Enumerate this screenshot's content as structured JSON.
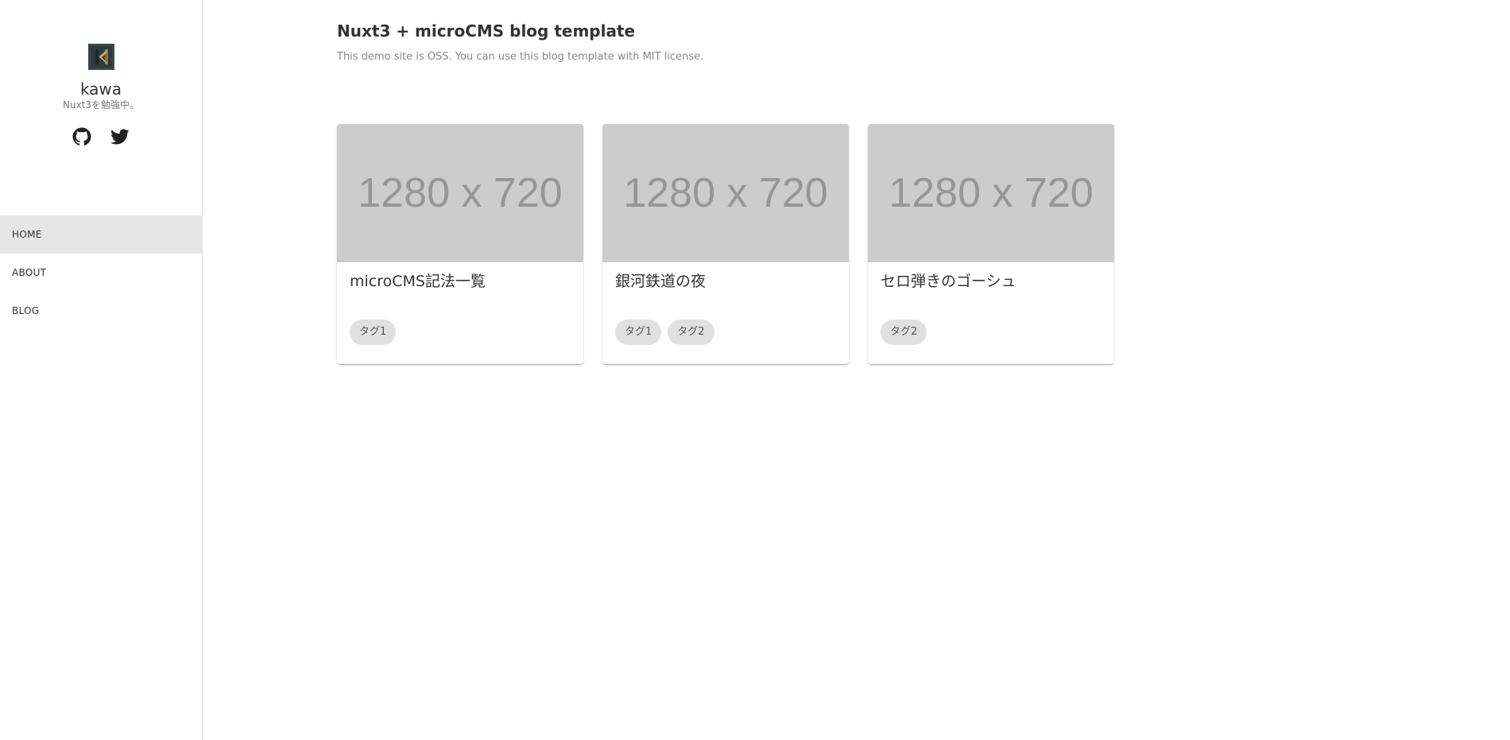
{
  "sidebar": {
    "profile": {
      "avatar_icon": "k-logo-icon",
      "name": "kawa",
      "description": "Nuxt3を勉強中。"
    },
    "social": [
      {
        "icon": "github-icon"
      },
      {
        "icon": "twitter-icon"
      }
    ],
    "nav": [
      {
        "label": "HOME",
        "active": true
      },
      {
        "label": "ABOUT",
        "active": false
      },
      {
        "label": "BLOG",
        "active": false
      }
    ]
  },
  "main": {
    "title": "Nuxt3 + microCMS blog template",
    "subtitle": "This demo site is OSS. You can use this blog template with MIT license.",
    "posts": [
      {
        "thumbnail_text": "1280 x 720",
        "title": "microCMS記法一覧",
        "tags": [
          "タグ1"
        ]
      },
      {
        "thumbnail_text": "1280 x 720",
        "title": "銀河鉄道の夜",
        "tags": [
          "タグ1",
          "タグ2"
        ]
      },
      {
        "thumbnail_text": "1280 x 720",
        "title": "セロ弾きのゴーシュ",
        "tags": [
          "タグ2"
        ]
      }
    ]
  },
  "colors": {
    "nav_active_bg": "#e6e6e6",
    "thumbnail_bg": "#cccccc",
    "tag_bg": "#e0e0e0"
  }
}
